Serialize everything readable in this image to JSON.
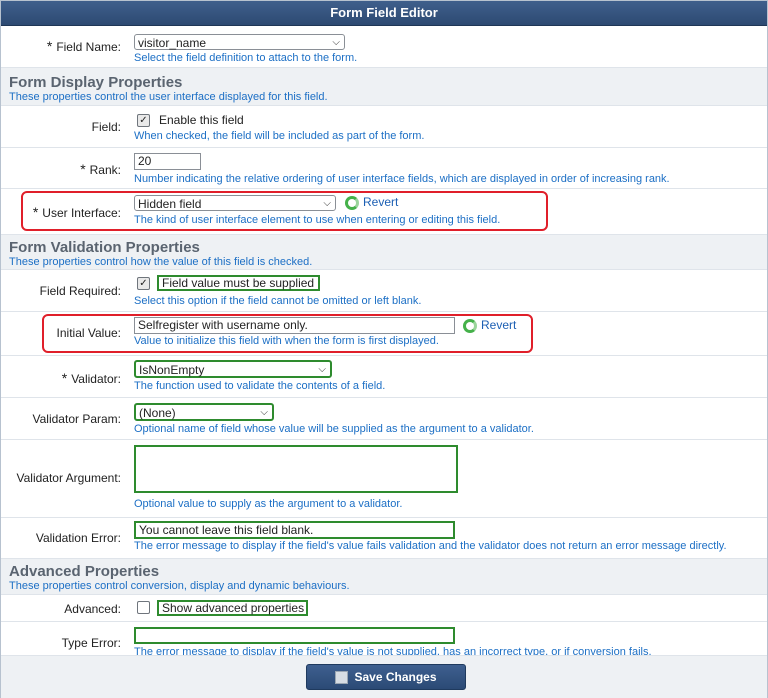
{
  "title": "Form Field Editor",
  "field_name": {
    "label": "Field Name:",
    "value": "visitor_name",
    "help": "Select the field definition to attach to the form."
  },
  "display_section": {
    "title": "Form Display Properties",
    "desc": "These properties control the user interface displayed for this field."
  },
  "field": {
    "label": "Field:",
    "checkbox_label": "Enable this field",
    "checked": true,
    "help": "When checked, the field will be included as part of the form."
  },
  "rank": {
    "label": "Rank:",
    "value": "20",
    "help": "Number indicating the relative ordering of user interface fields, which are displayed in order of increasing rank."
  },
  "user_interface": {
    "label": "User Interface:",
    "value": "Hidden field",
    "revert": "Revert",
    "help": "The kind of user interface element to use when entering or editing this field."
  },
  "validation_section": {
    "title": "Form Validation Properties",
    "desc": "These properties control how the value of this field is checked."
  },
  "field_required": {
    "label": "Field Required:",
    "checkbox_label": "Field value must be supplied",
    "checked": true,
    "help": "Select this option if the field cannot be omitted or left blank."
  },
  "initial_value": {
    "label": "Initial Value:",
    "value": "Selfregister with username only.",
    "revert": "Revert",
    "help": "Value to initialize this field with when the form is first displayed."
  },
  "validator": {
    "label": "Validator:",
    "value": "IsNonEmpty",
    "help": "The function used to validate the contents of a field."
  },
  "validator_param": {
    "label": "Validator Param:",
    "value": "(None)",
    "help": "Optional name of field whose value will be supplied as the argument to a validator."
  },
  "validator_argument": {
    "label": "Validator Argument:",
    "value": "",
    "help": "Optional value to supply as the argument to a validator."
  },
  "validation_error": {
    "label": "Validation Error:",
    "value": "You cannot leave this field blank.",
    "help": "The error message to display if the field's value fails validation and the validator does not return an error message directly."
  },
  "advanced_section": {
    "title": "Advanced Properties",
    "desc": "These properties control conversion, display and dynamic behaviours."
  },
  "advanced": {
    "label": "Advanced:",
    "checkbox_label": "Show advanced properties",
    "checked": false
  },
  "type_error": {
    "label": "Type Error:",
    "value": "",
    "help": "The error message to display if the field's value is not supplied, has an incorrect type, or if conversion fails."
  },
  "save_label": "Save Changes",
  "required_mark": "*",
  "colors": {
    "title_bar": "#2d4a72",
    "help_text": "#1c6fc5",
    "highlight_red": "#e01f2a",
    "highlight_green": "#2e8b2e"
  }
}
